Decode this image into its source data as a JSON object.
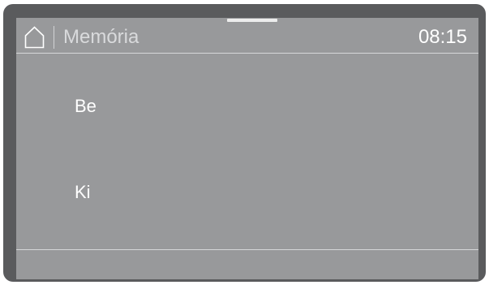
{
  "header": {
    "home_icon": "home-icon",
    "title": "Memória",
    "time": "08:15"
  },
  "menu": {
    "items": [
      {
        "label": "Be"
      },
      {
        "label": "Ki"
      }
    ]
  },
  "colors": {
    "screen_background": "#98999b",
    "bezel": "#5a5b5d",
    "text": "#ffffff",
    "title_text": "#d9dadc"
  }
}
